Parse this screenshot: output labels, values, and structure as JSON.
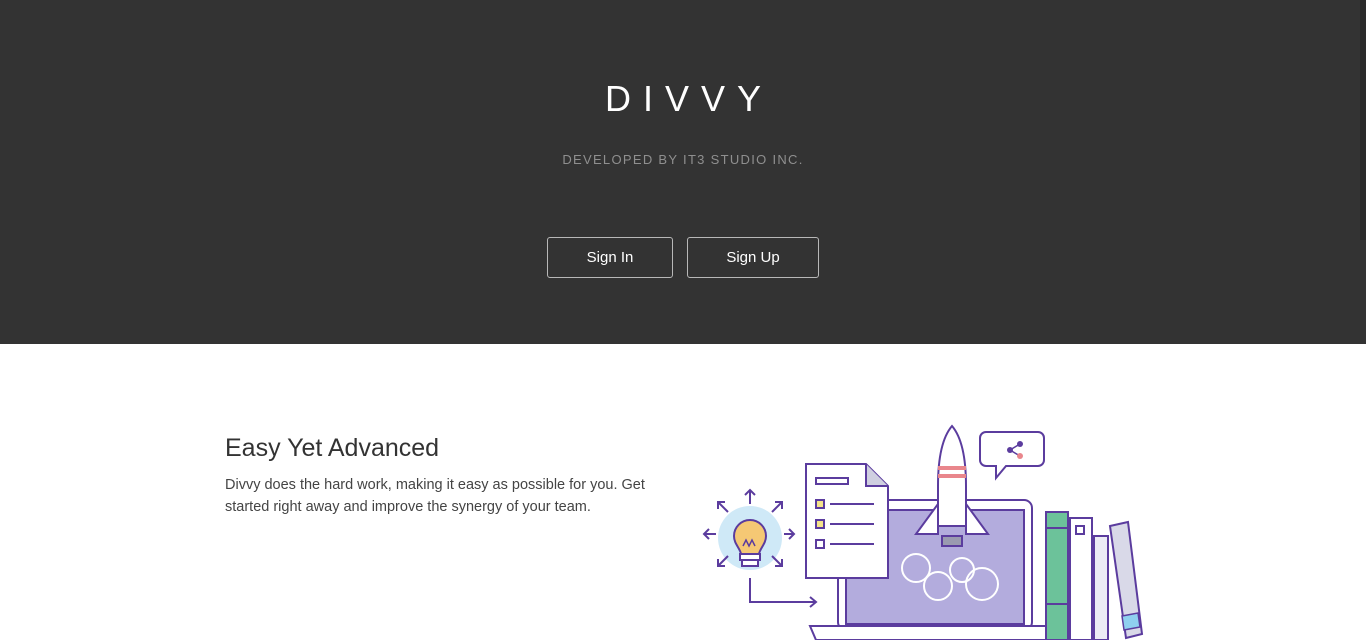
{
  "hero": {
    "brand": "DIVVY",
    "tagline": "DEVELOPED BY IT3 STUDIO INC.",
    "sign_in_label": "Sign In",
    "sign_up_label": "Sign Up"
  },
  "feature": {
    "title": "Easy Yet Advanced",
    "description": "Divvy does the hard work, making it easy as possible for you. Get started right away and improve the synergy of your team."
  },
  "colors": {
    "hero_bg": "#333333",
    "accent_purple": "#5b3c9e",
    "screen_lavender": "#b3acdd",
    "bulb_yellow": "#f5c874",
    "book_green": "#6cc29a"
  },
  "icons": [
    "lightbulb-icon",
    "document-checklist-icon",
    "rocket-icon",
    "share-bubble-icon",
    "laptop-icon",
    "books-icon"
  ]
}
